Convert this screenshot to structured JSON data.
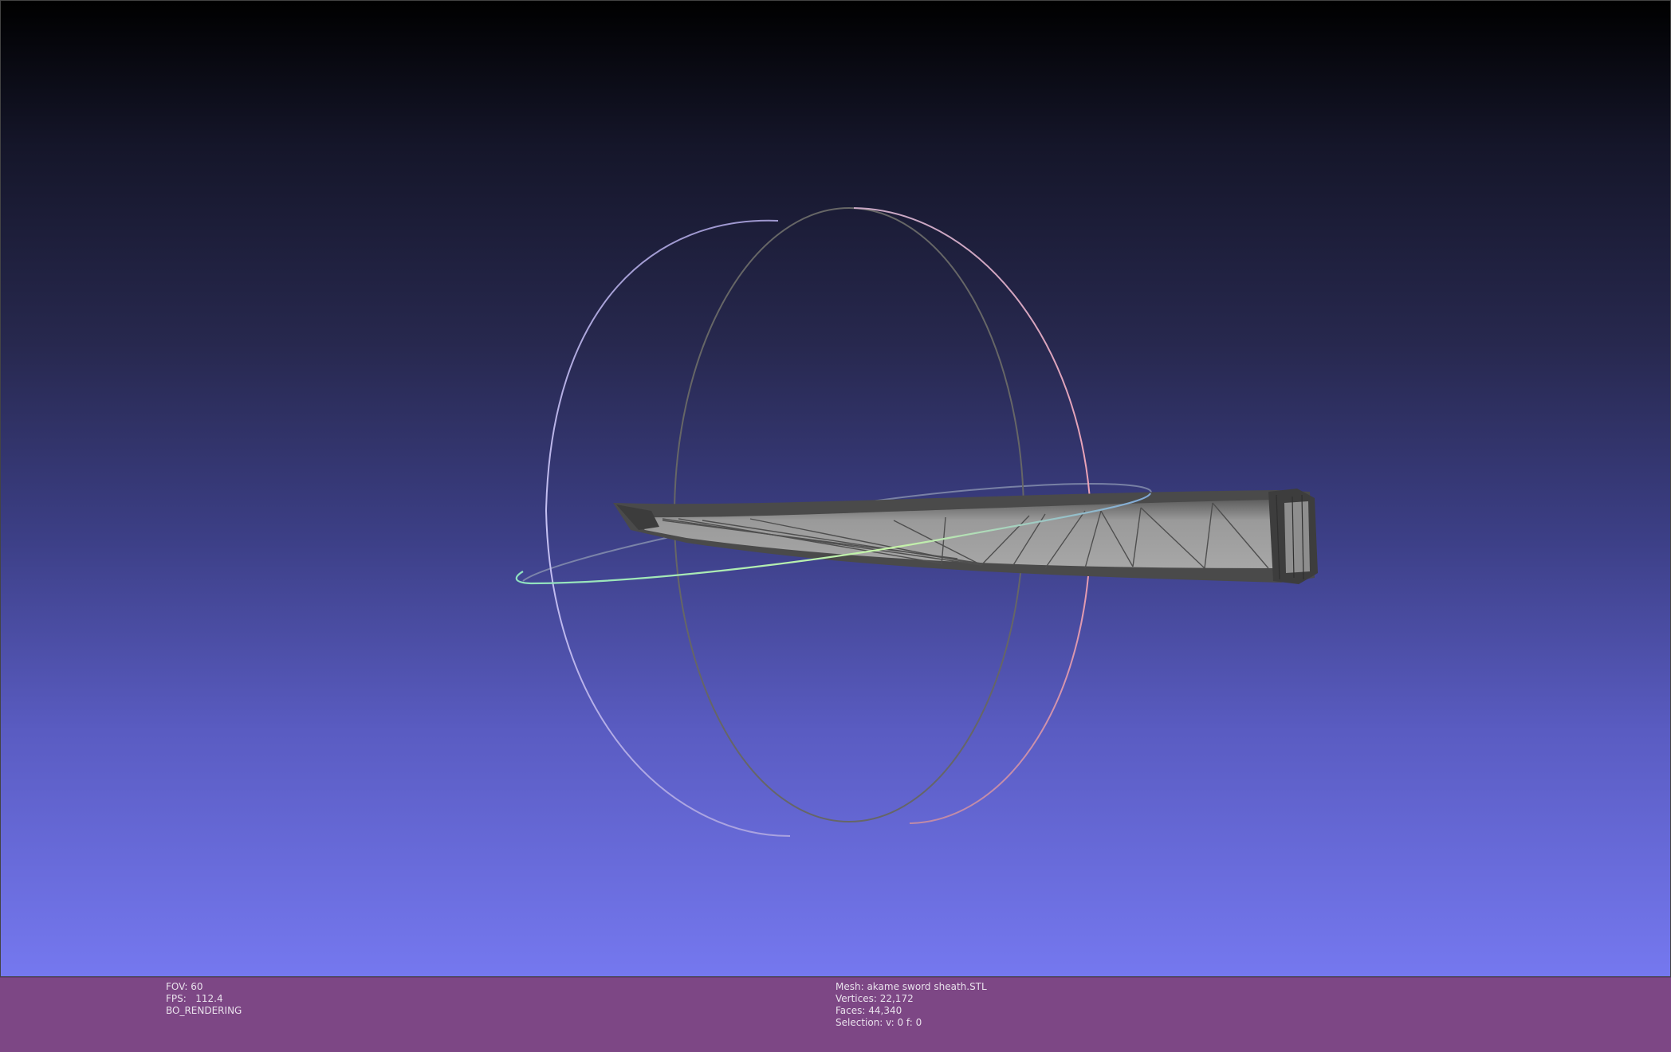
{
  "viewer": {
    "background_top": "#000000",
    "background_bottom": "#7578ef",
    "trackball_colors": {
      "x_ring": "#e39aa8",
      "y_ring": "#b2a9ef",
      "z_ring": "#9fe7c8",
      "inner_ring": "#6a6a6a"
    },
    "mesh_icon": "sword-sheath-mesh"
  },
  "status_left": {
    "fov": "FOV: 60",
    "fps": "FPS:   112.4",
    "mode": "BO_RENDERING"
  },
  "status_right": {
    "mesh": "Mesh: akame sword sheath.STL",
    "vertices": "Vertices: 22,172",
    "faces": "Faces: 44,340",
    "selection": "Selection: v: 0 f: 0"
  }
}
